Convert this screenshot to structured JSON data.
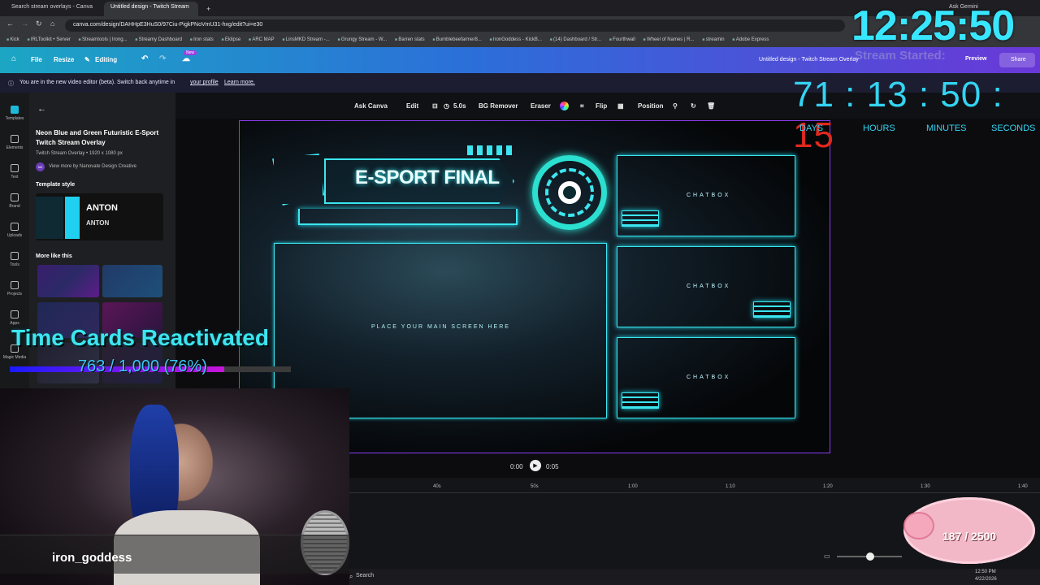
{
  "browser": {
    "tabs": [
      {
        "label": "Search stream overlays - Canva",
        "active": false
      },
      {
        "label": "Untitled design - Twitch Stream",
        "active": true
      }
    ],
    "url": "canva.com/design/DAHHpE3HuS0/97Ciu-PigkPNoVmU31-hxg/edit?ui=e30",
    "bookmarks": [
      "Kick",
      "IRLToolkit • Server",
      "Streamtools | Irong...",
      "Streamy Dashboard",
      "Iron stats",
      "Eklipse",
      "ARC MAP",
      "LinsMKD Stream -...",
      "Grungy Stream - W...",
      "Barren stats",
      "Bumblebeefarmer8...",
      "IronGoddess - KickB...",
      "(14) Dashboard / Str...",
      "Fourthwall",
      "Wheel of Names | R...",
      "streamin",
      "Adobe Express"
    ],
    "ask_gemini": "Ask Gemini"
  },
  "canva_bar": {
    "file": "File",
    "resize": "Resize",
    "editing": "Editing",
    "new_badge": "New",
    "doc_title": "Untitled design - Twitch Stream Overlay",
    "preview": "Preview",
    "share": "Share"
  },
  "banner": {
    "text": "You are in the new video editor (beta). Switch back anytime in",
    "profile_link": "your profile",
    "learn_more": "Learn more."
  },
  "rail": [
    "Templates",
    "Elements",
    "Text",
    "Brand",
    "Uploads",
    "Tools",
    "Projects",
    "Apps",
    "Magic Media"
  ],
  "panel": {
    "title": "Neon Blue and Green Futuristic E-Sport Twitch Stream Overlay",
    "subtitle": "Twitch Stream Overlay • 1920 x 1080 px",
    "author": "View more by Nanovate Design Creative",
    "author_initials": "ND",
    "template_style": "Template style",
    "font_preview_1": "ANTON",
    "font_preview_2": "ANTON",
    "more_like_this": "More like this"
  },
  "toolbar": {
    "ask_canva": "Ask Canva",
    "edit": "Edit",
    "duration": "5.0s",
    "bg_remover": "BG Remover",
    "eraser": "Eraser",
    "flip": "Flip",
    "position": "Position"
  },
  "overlay_design": {
    "title": "E-SPORT FINAL",
    "chatbox": "CHATBOX",
    "main_screen": "PLACE YOUR MAIN SCREEN HERE"
  },
  "playback": {
    "current": "0:00",
    "total": "0:05"
  },
  "timeline_ticks": [
    "40s",
    "50s",
    "1:00",
    "1:10",
    "1:20",
    "1:30",
    "1:40"
  ],
  "taskbar": {
    "search": "Search",
    "time": "12:50 PM",
    "date": "4/22/2026"
  },
  "stream_overlays": {
    "clock": "12:25:50",
    "stream_started": "Stream Started:",
    "countdown": {
      "days": "71",
      "hours": "13",
      "minutes": "50",
      "seconds": "15"
    },
    "countdown_labels": [
      "DAYS",
      "HOURS",
      "MINUTES",
      "SECONDS"
    ],
    "timecards_title": "Time Cards Reactivated",
    "timecards_progress_text": "763 / 1,000 (76%)",
    "timecards_progress_fraction": 0.763,
    "streamer_name": "iron_goddess",
    "goal_text": "187 / 2500"
  },
  "colors": {
    "accent": "#3be6f0",
    "canvas_border": "#8b3cf0",
    "countdown_seconds": "#e0281e"
  }
}
